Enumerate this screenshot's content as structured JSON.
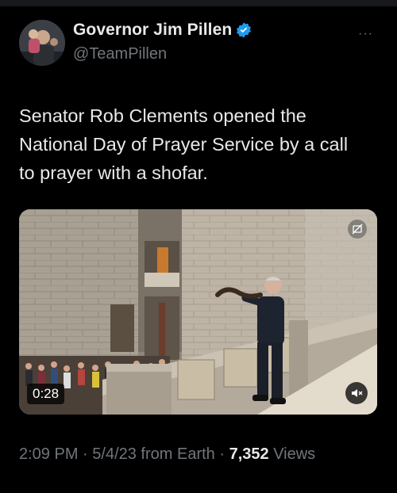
{
  "tweet": {
    "author_name": "Governor Jim Pillen",
    "author_handle": "@TeamPillen",
    "more_label": "···",
    "text": "Senator Rob Clements opened the National Day of Prayer Service by a call to prayer with a shofar.",
    "video": {
      "duration": "0:28"
    },
    "meta": {
      "time": "2:09 PM",
      "separator1": " · ",
      "date": "5/4/23",
      "source": " from Earth",
      "separator2": " · ",
      "views_count": "7,352",
      "views_label": " Views"
    }
  },
  "colors": {
    "background": "#000000",
    "text": "#e7e9ea",
    "secondary_text": "#71767b",
    "verified_badge": "#1d9bf0"
  }
}
